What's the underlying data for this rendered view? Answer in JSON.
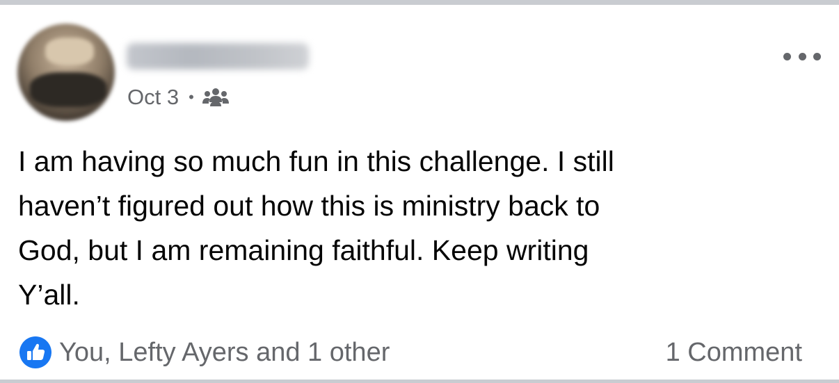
{
  "post": {
    "author_name": "Lori Wilson",
    "date": "Oct 3",
    "separator": "•",
    "audience_icon": "group-icon",
    "more_icon": "more-options-icon",
    "text": "I am having so much fun in this challenge.  I still\nhaven’t figured out how this is ministry back to\nGod, but I am remaining faithful.  Keep writing\nY’all.",
    "reactions": {
      "icon": "like-icon",
      "summary": "You, Lefty Ayers and 1 other"
    },
    "comments_count": "1 Comment"
  },
  "colors": {
    "like_blue": "#1877f2",
    "secondary_text": "#65676b",
    "primary_text": "#050505",
    "divider": "#c9ccd1"
  }
}
